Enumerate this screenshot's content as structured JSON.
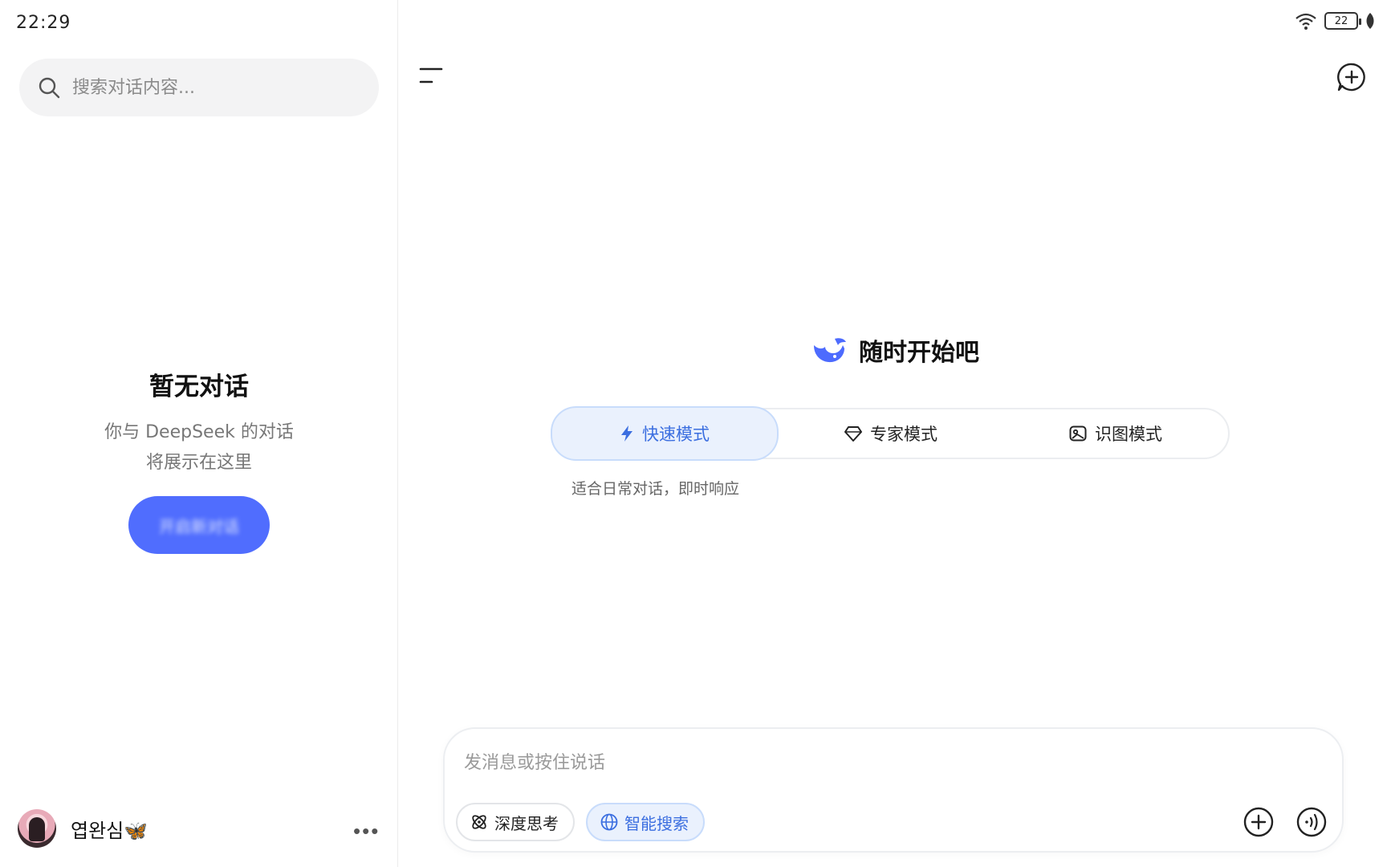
{
  "status_bar": {
    "time": "22:29",
    "battery": "22",
    "icons": [
      "wifi-icon",
      "battery-icon",
      "leaf-icon"
    ]
  },
  "sidebar": {
    "search": {
      "placeholder": "搜索对话内容...",
      "value": ""
    },
    "empty_state": {
      "title": "暂无对话",
      "line1": "你与 DeepSeek 的对话",
      "line2": "将展示在这里",
      "button_label": "开启新对话"
    },
    "profile": {
      "name": "엽완심🦋",
      "more_label": "•••"
    }
  },
  "main": {
    "hero_title": "随时开始吧",
    "modes": [
      {
        "label": "快速模式",
        "icon": "lightning-icon",
        "active": true
      },
      {
        "label": "专家模式",
        "icon": "diamond-icon",
        "active": false
      },
      {
        "label": "识图模式",
        "icon": "image-icon",
        "active": false
      }
    ],
    "mode_description": "适合日常对话，即时响应",
    "composer": {
      "placeholder": "发消息或按住说话",
      "value": "",
      "chips": [
        {
          "label": "深度思考",
          "icon": "atom-icon",
          "active": false
        },
        {
          "label": "智能搜索",
          "icon": "globe-icon",
          "active": true
        }
      ]
    }
  },
  "colors": {
    "accent": "#4d6bfe",
    "active_blue": "#3b6ee0",
    "active_bg": "#eaf1fd"
  }
}
